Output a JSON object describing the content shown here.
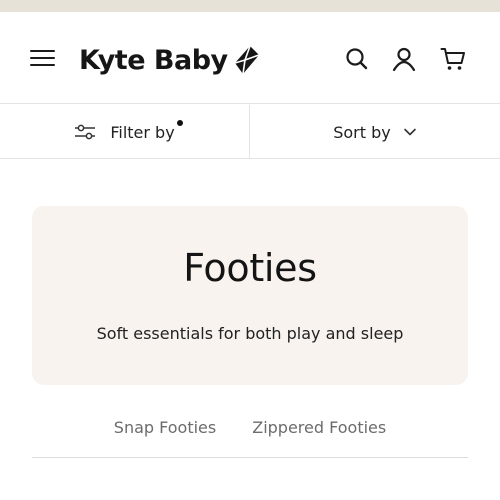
{
  "header": {
    "brand": "Kyte Baby",
    "icons": {
      "menu": "hamburger-menu-icon",
      "logo_mark": "kite-logo-icon",
      "search": "search-icon",
      "account": "user-icon",
      "cart": "cart-icon"
    }
  },
  "toolbar": {
    "filter_label": "Filter by",
    "filter_icon": "sliders-icon",
    "sort_label": "Sort by",
    "sort_icon": "chevron-down-icon"
  },
  "hero": {
    "title": "Footies",
    "subtitle": "Soft essentials for both play and sleep",
    "background": "#f8f3ef"
  },
  "subnav": {
    "items": [
      {
        "label": "Snap Footies"
      },
      {
        "label": "Zippered Footies"
      }
    ]
  },
  "colors": {
    "top_strip": "#e6e2d8",
    "text": "#1b1b1b",
    "muted_text": "#6c6c6c"
  }
}
